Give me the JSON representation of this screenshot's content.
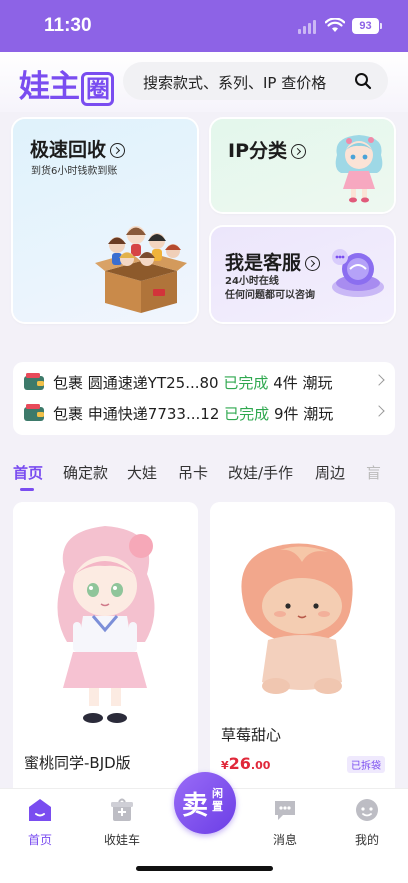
{
  "status_bar": {
    "time": "11:30",
    "battery": "93"
  },
  "header": {
    "logo": "娃主",
    "logo_boxed": "圈",
    "search_placeholder": "搜索款式、系列、IP 查价格"
  },
  "cards": {
    "recycle": {
      "title": "极速回收",
      "subtitle": "到货6小时钱款到账"
    },
    "ip": {
      "title": "IP分类"
    },
    "service": {
      "title": "我是客服",
      "line1": "24小时在线",
      "line2": "任何问题都可以咨询"
    }
  },
  "orders": [
    {
      "type": "包裹",
      "tracking": "圆通速递YT25...80",
      "status": "已完成",
      "count": "4件",
      "category": "潮玩"
    },
    {
      "type": "包裹",
      "tracking": "申通快递7733...12",
      "status": "已完成",
      "count": "9件",
      "category": "潮玩"
    }
  ],
  "tabs": [
    "首页",
    "确定款",
    "大娃",
    "吊卡",
    "改娃/手作",
    "周边",
    "盲"
  ],
  "products": [
    {
      "name": "蜜桃同学-BJD版",
      "price_yen": "¥",
      "price_int": "",
      "price_dec": ""
    },
    {
      "name": "草莓甜心",
      "price_yen": "¥",
      "price_int": "26",
      "price_dec": ".00",
      "badge": "已拆袋"
    }
  ],
  "bottom_nav": {
    "home": "首页",
    "cart": "收娃车",
    "sell_big": "卖",
    "sell_small": "闲置",
    "messages": "消息",
    "mine": "我的"
  },
  "colors": {
    "accent": "#7a4df0",
    "status_bar": "#8d63e6",
    "done": "#2fa84f",
    "price": "#e0283a"
  }
}
